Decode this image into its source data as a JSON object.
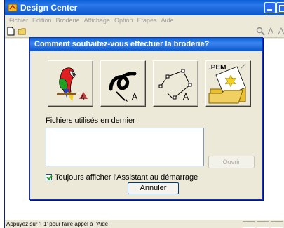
{
  "app": {
    "title": "Design Center",
    "menu": [
      "Fichier",
      "Edition",
      "Broderie",
      "Affichage",
      "Option",
      "Etapes",
      "Aide"
    ],
    "status": "Appuyez sur 'F1' pour faire appel à l'Aide"
  },
  "dialog": {
    "title": "Comment souhaitez-vous effectuer la broderie?",
    "modes": [
      {
        "icon": "parrot-image-icon"
      },
      {
        "icon": "freehand-stroke-icon"
      },
      {
        "icon": "point-path-icon"
      },
      {
        "icon": "pem-file-folder-icon",
        "badge": ".PEM"
      }
    ],
    "recent_label": "Fichiers utilisés en dernier",
    "open_label": "Ouvrir",
    "startup_label": "Toujours afficher l'Assistant au démarrage",
    "startup_checked": true,
    "cancel_label": "Annuler"
  },
  "colors": {
    "titlebar": "#0a55c9",
    "window_bg": "#ece9d8"
  }
}
